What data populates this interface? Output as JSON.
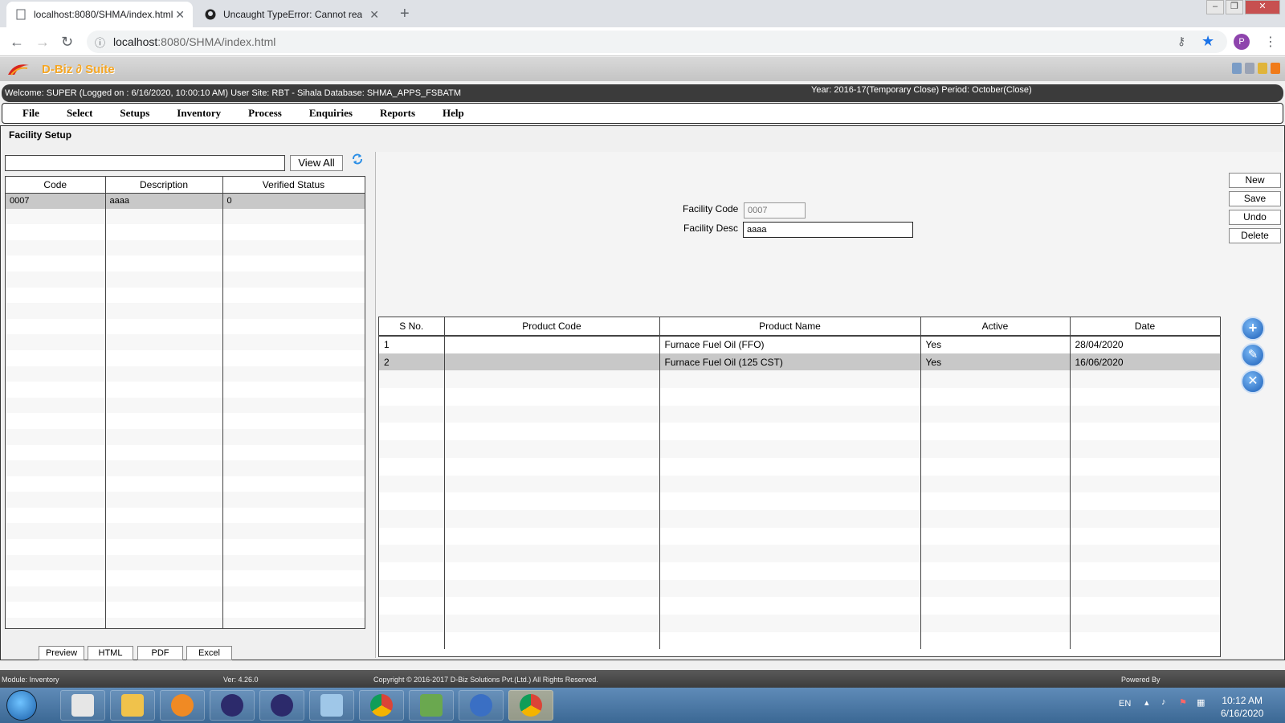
{
  "browser": {
    "tabs": [
      {
        "title": "localhost:8080/SHMA/index.html",
        "active": true
      },
      {
        "title": "Uncaught TypeError: Cannot rea",
        "active": false
      }
    ],
    "url_host": "localhost",
    "url_rest": ":8080/SHMA/index.html",
    "profile_initial": "P"
  },
  "app": {
    "suite_name": "D-Biz ∂ Suite",
    "welcome_left": "Welcome: SUPER (Logged on : 6/16/2020, 10:00:10 AM) User Site: RBT - Sihala Database: SHMA_APPS_FSBATM",
    "welcome_right": "Year: 2016-17(Temporary Close) Period: October(Close)",
    "menu": [
      "File",
      "Select",
      "Setups",
      "Inventory",
      "Process",
      "Enquiries",
      "Reports",
      "Help"
    ]
  },
  "page": {
    "title": "Facility Setup",
    "search_value": "",
    "view_all_label": "View All",
    "left_columns": [
      "Code",
      "Description",
      "Verified Status"
    ],
    "left_rows": [
      {
        "code": "0007",
        "description": "aaaa",
        "status": "0"
      }
    ],
    "export_buttons": [
      "Preview",
      "HTML",
      "PDF",
      "Excel"
    ],
    "facility_code_label": "Facility Code",
    "facility_code_value": "0007",
    "facility_desc_label": "Facility Desc",
    "facility_desc_value": "aaaa",
    "action_buttons": [
      "New",
      "Save",
      "Undo",
      "Delete"
    ],
    "right_columns": [
      "S No.",
      "Product Code",
      "Product Name",
      "Active",
      "Date"
    ],
    "right_rows": [
      {
        "sno": "1",
        "product_code": "",
        "product_name": "Furnace Fuel Oil (FFO)",
        "active": "Yes",
        "date": "28/04/2020"
      },
      {
        "sno": "2",
        "product_code": "",
        "product_name": "Furnace Fuel Oil (125 CST)",
        "active": "Yes",
        "date": "16/06/2020"
      }
    ],
    "grid_tools": [
      "add-icon",
      "edit-icon",
      "delete-icon"
    ]
  },
  "status": {
    "module": "Module: Inventory",
    "version": "Ver: 4.26.0",
    "copyright": "Copyright © 2016-2017 D-Biz Solutions Pvt.(Ltd.) All Rights Reserved.",
    "powered_by": "Powered By"
  },
  "taskbar": {
    "language": "EN",
    "time": "10:12 AM",
    "date": "6/16/2020"
  },
  "colors": {
    "accent_orange": "#f5a623",
    "welcome_bar": "#3b3b3b",
    "selected_row": "#c8c8c8",
    "taskbar": "#3b6894"
  }
}
